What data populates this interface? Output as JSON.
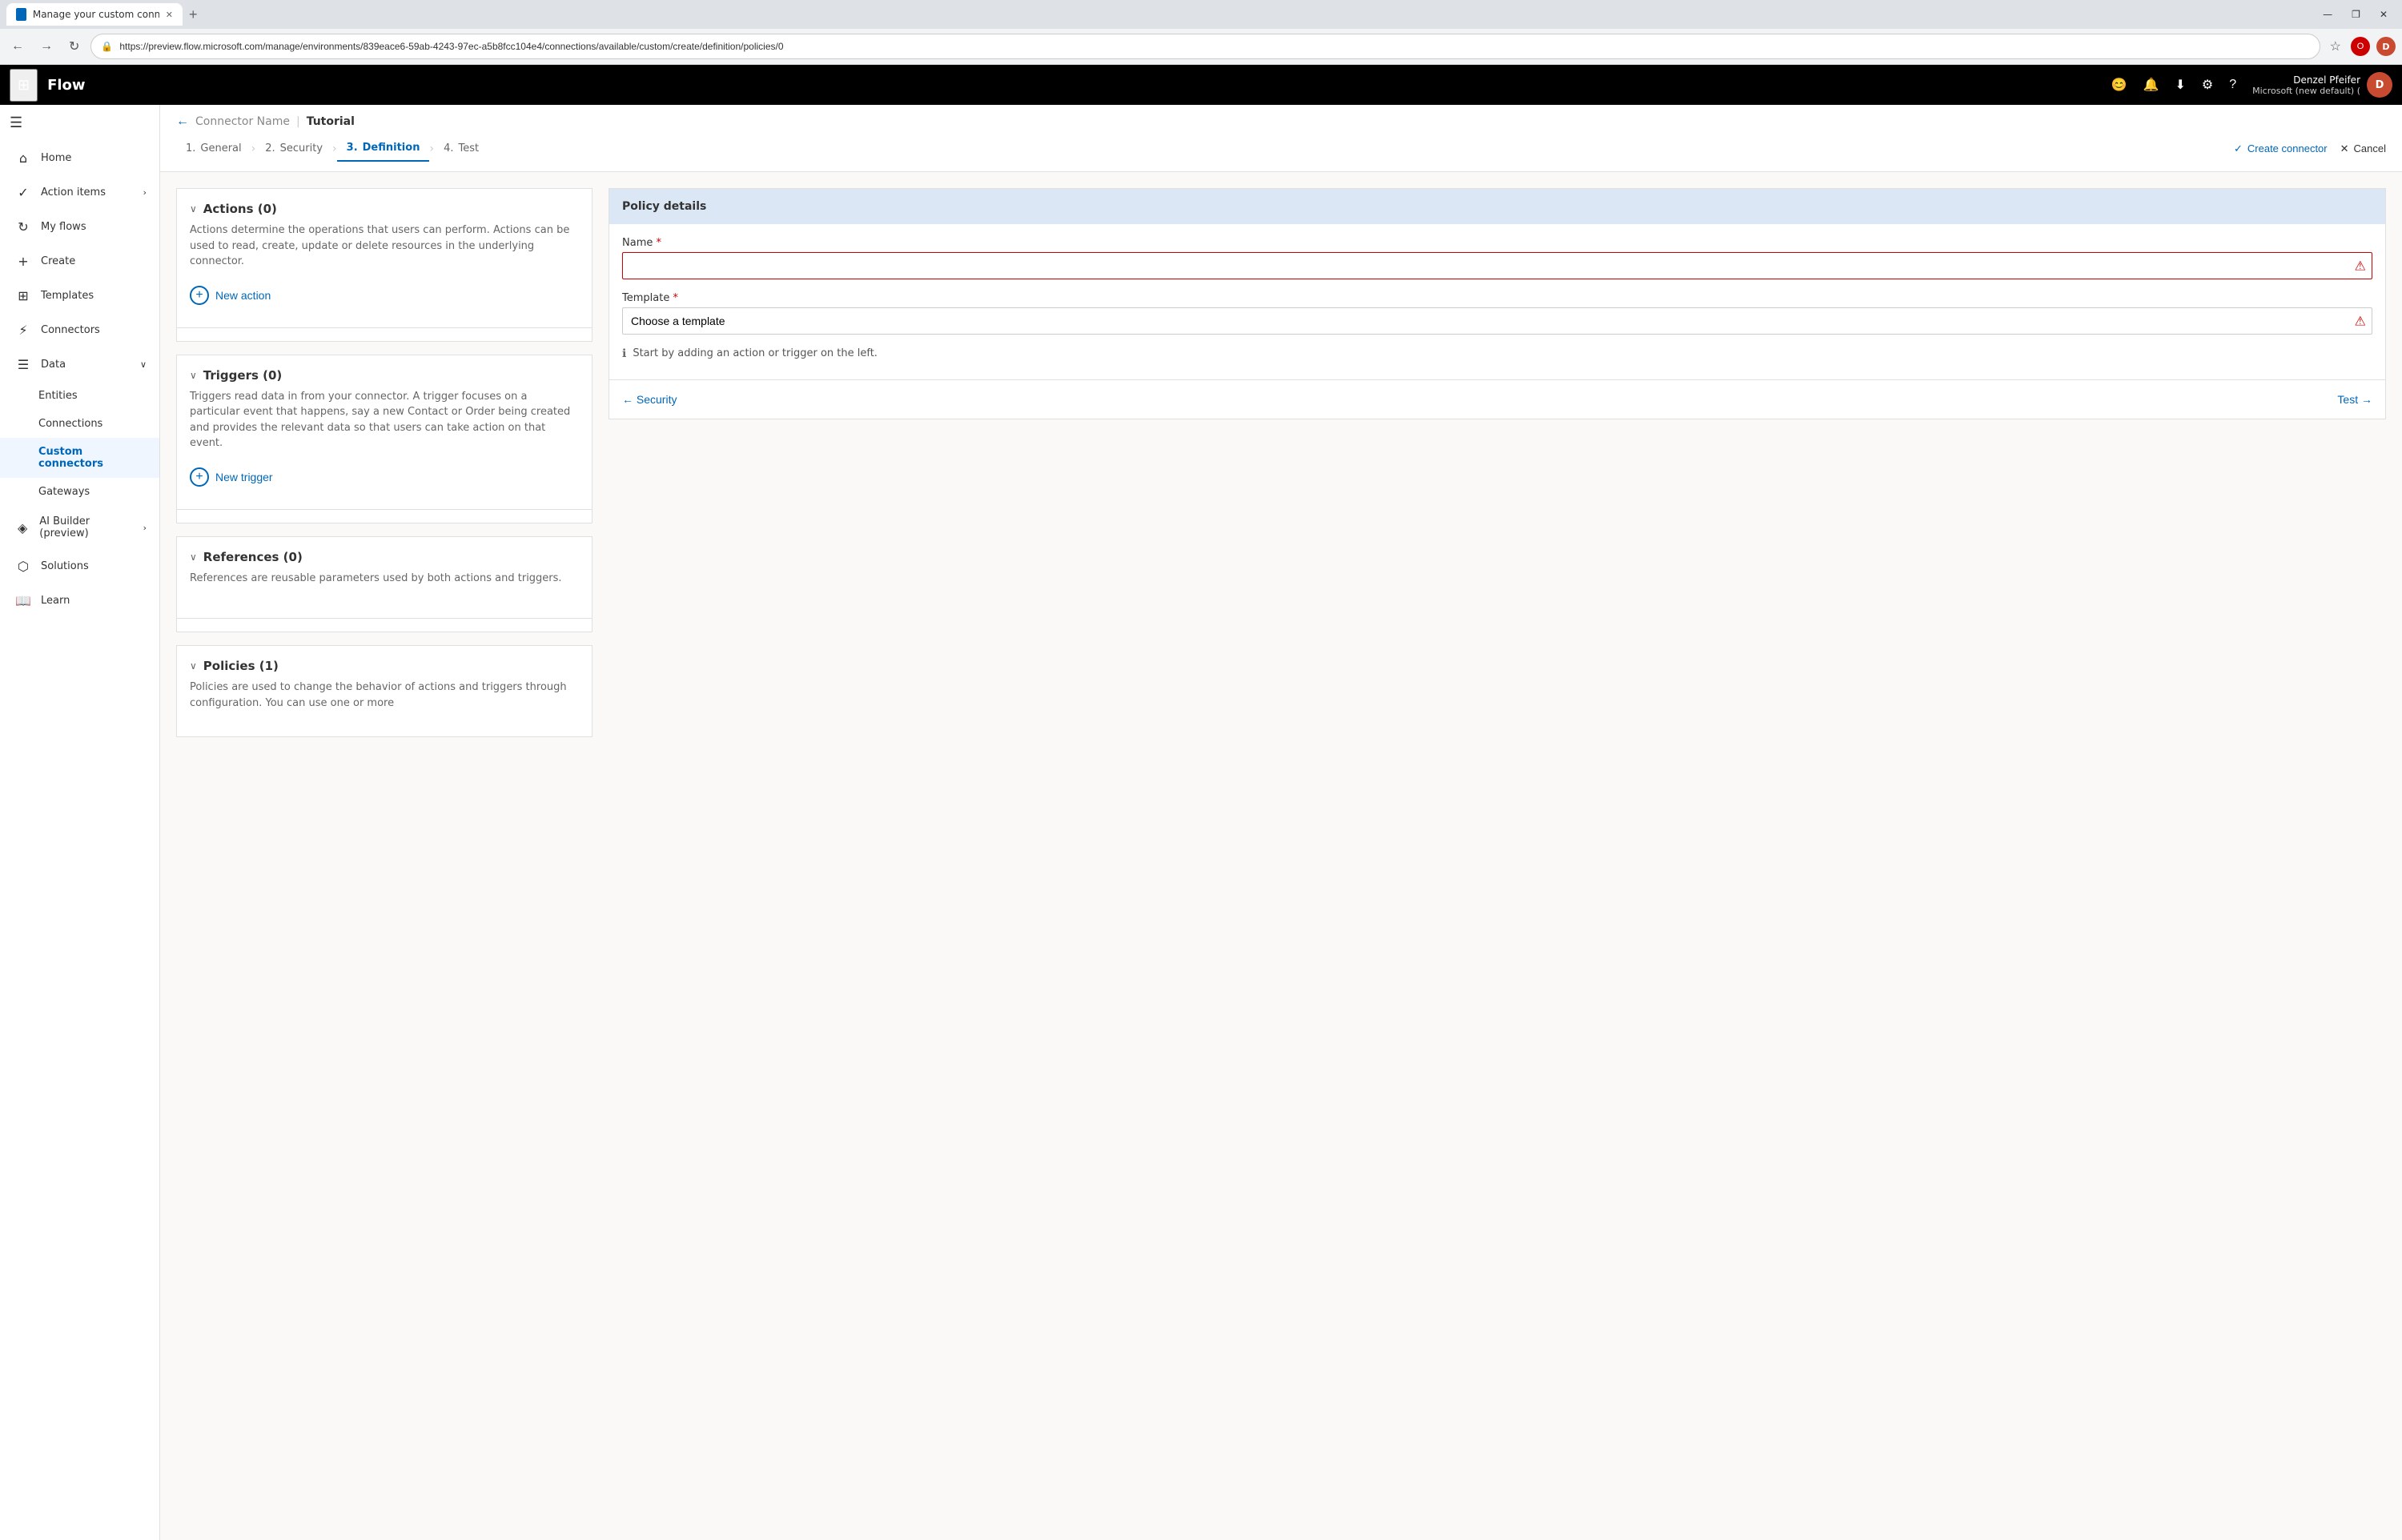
{
  "browser": {
    "tab_title": "Manage your custom connectors",
    "url": "https://preview.flow.microsoft.com/manage/environments/839eace6-59ab-4243-97ec-a5b8fcc104e4/connections/available/custom/create/definition/policies/0",
    "new_tab_label": "+",
    "controls": {
      "minimize": "—",
      "maximize": "❐",
      "close": "✕"
    }
  },
  "navbar": {
    "waffle_icon": "⊞",
    "logo": "Flow",
    "icons": [
      "😊",
      "🔔",
      "⬇",
      "⚙",
      "?"
    ],
    "user": {
      "name": "Denzel Pfeifer",
      "org": "Microsoft (new default) (",
      "initials": "D"
    }
  },
  "sidebar": {
    "menu_icon": "☰",
    "items": [
      {
        "id": "home",
        "icon": "⌂",
        "label": "Home"
      },
      {
        "id": "action-items",
        "icon": "✓",
        "label": "Action items",
        "hasChevron": true
      },
      {
        "id": "my-flows",
        "icon": "↻",
        "label": "My flows"
      },
      {
        "id": "create",
        "icon": "+",
        "label": "Create"
      },
      {
        "id": "templates",
        "icon": "⊞",
        "label": "Templates"
      },
      {
        "id": "connectors",
        "icon": "⚡",
        "label": "Connectors"
      },
      {
        "id": "data",
        "icon": "☰",
        "label": "Data",
        "hasChevron": true,
        "expanded": true
      },
      {
        "id": "entities",
        "sub": true,
        "label": "Entities"
      },
      {
        "id": "connections",
        "sub": true,
        "label": "Connections"
      },
      {
        "id": "custom-connectors",
        "sub": true,
        "label": "Custom connectors",
        "active": true
      },
      {
        "id": "gateways",
        "sub": true,
        "label": "Gateways"
      },
      {
        "id": "ai-builder",
        "icon": "◈",
        "label": "AI Builder (preview)",
        "hasChevron": true
      },
      {
        "id": "solutions",
        "icon": "⬡",
        "label": "Solutions"
      },
      {
        "id": "learn",
        "icon": "📖",
        "label": "Learn"
      }
    ]
  },
  "page": {
    "breadcrumb_back": "←",
    "connector_name_label": "Connector Name",
    "connector_tutorial": "Tutorial"
  },
  "wizard": {
    "steps": [
      {
        "num": "1.",
        "label": "General"
      },
      {
        "num": "2.",
        "label": "Security"
      },
      {
        "num": "3.",
        "label": "Definition",
        "active": true
      },
      {
        "num": "4.",
        "label": "Test"
      }
    ],
    "create_connector": "Create connector",
    "cancel": "Cancel"
  },
  "definition": {
    "actions_section": {
      "title": "Actions (0)",
      "description": "Actions determine the operations that users can perform. Actions can be used to read, create, update or delete resources in the underlying connector.",
      "add_btn": "New action"
    },
    "triggers_section": {
      "title": "Triggers (0)",
      "description": "Triggers read data in from your connector. A trigger focuses on a particular event that happens, say a new Contact or Order being created and provides the relevant data so that users can take action on that event.",
      "add_btn": "New trigger"
    },
    "references_section": {
      "title": "References (0)",
      "description": "References are reusable parameters used by both actions and triggers."
    },
    "policies_section": {
      "title": "Policies (1)",
      "description": "Policies are used to change the behavior of actions and triggers through configuration. You can use one or more"
    }
  },
  "policy_panel": {
    "title": "Policy details",
    "name_label": "Name",
    "name_required": "*",
    "name_placeholder": "",
    "template_label": "Template",
    "template_required": "*",
    "template_placeholder": "Choose a template",
    "info_text": "Start by adding an action or trigger on the left.",
    "nav_back": "← Security",
    "nav_forward": "Test →"
  }
}
